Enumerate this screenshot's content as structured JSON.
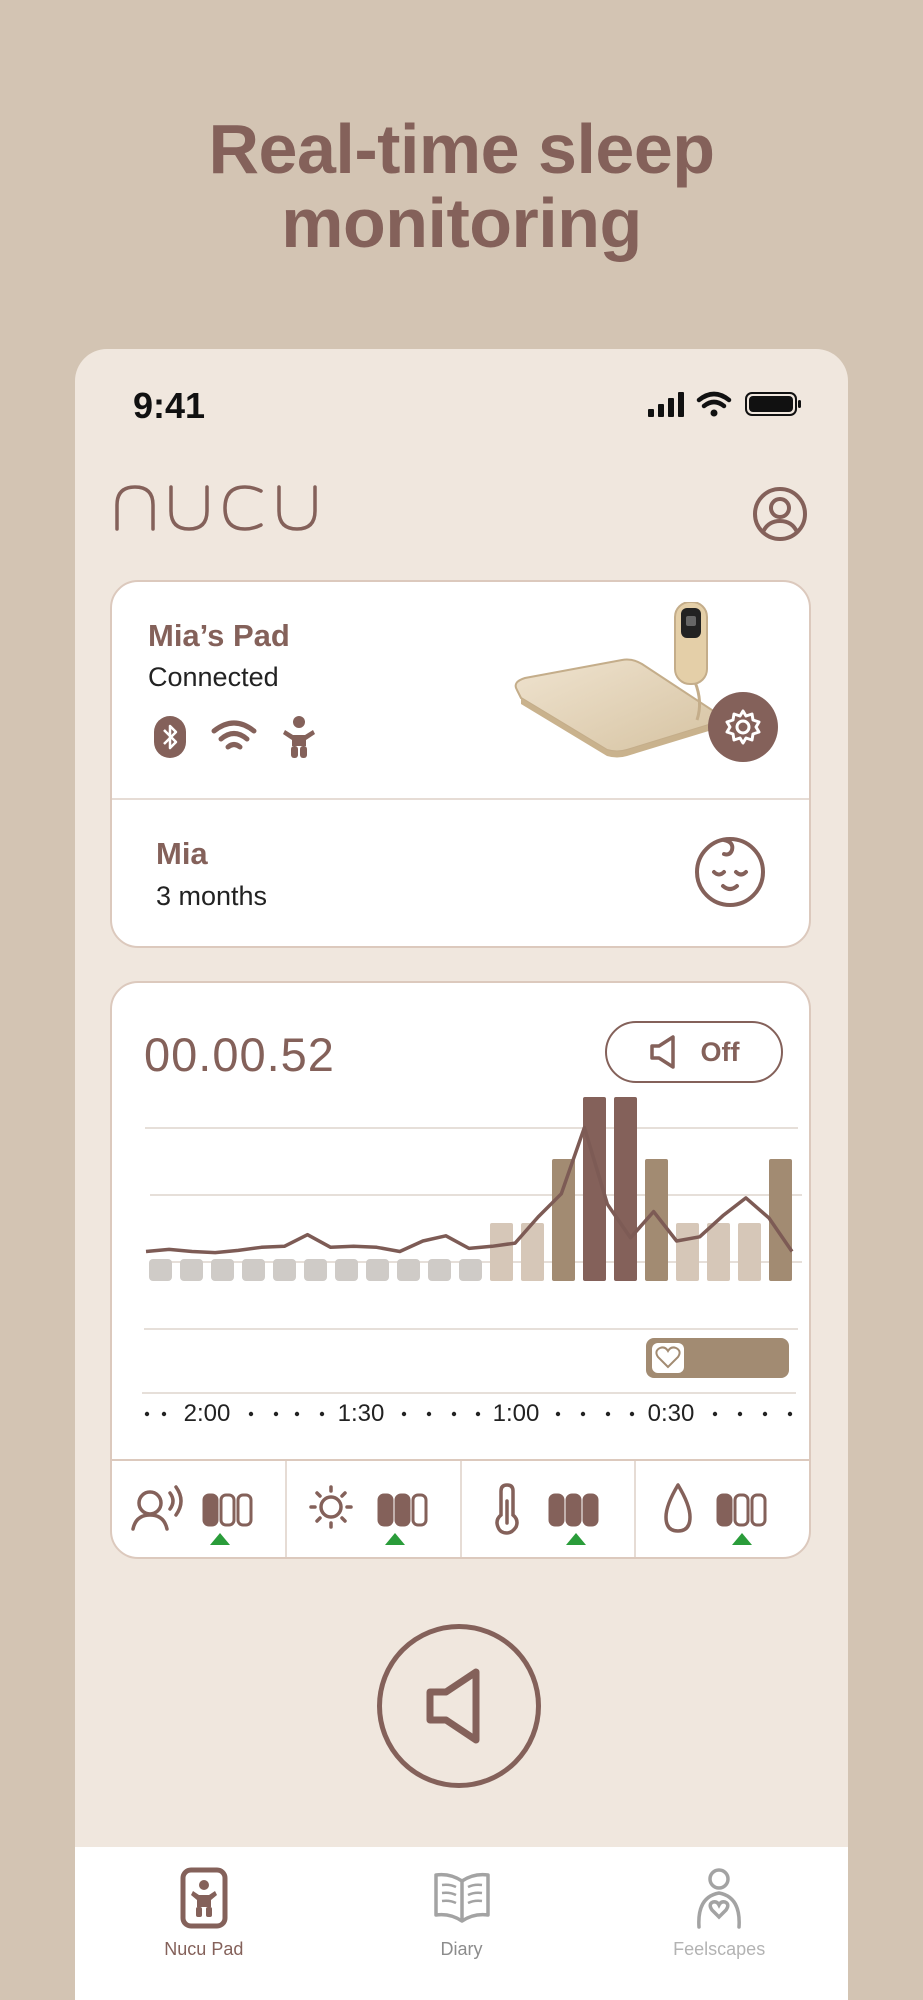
{
  "promo": {
    "headline_line1": "Real-time sleep",
    "headline_line2": "monitoring"
  },
  "status_bar": {
    "time": "9:41"
  },
  "app": {
    "logo_text": "nucu"
  },
  "device": {
    "name": "Mia’s Pad",
    "status": "Connected",
    "icons": [
      "bluetooth-icon",
      "wifi-icon",
      "baby-icon",
      "settings-gear-icon"
    ]
  },
  "baby": {
    "name": "Mia",
    "age": "3 months"
  },
  "monitor": {
    "timer": "00.00.52",
    "sound_toggle_label": "Off",
    "time_axis_labels": [
      "2:00",
      "1:30",
      "1:00",
      "0:30"
    ]
  },
  "chart_data": {
    "type": "bar",
    "bar_levels": [
      0,
      0,
      0,
      0,
      0,
      0,
      0,
      0,
      0,
      0,
      0,
      1,
      1,
      2,
      3,
      3,
      2,
      1,
      1,
      1,
      2
    ],
    "bar_level_legend": {
      "0": "none",
      "1": "light",
      "2": "medium",
      "3": "high"
    },
    "line_values": [
      3.0,
      3.2,
      3.0,
      2.9,
      3.1,
      3.4,
      3.5,
      4.6,
      3.4,
      3.5,
      3.4,
      3.0,
      4.0,
      4.5,
      3.3,
      3.5,
      3.8,
      6.3,
      8.5,
      14.8,
      7.5,
      4.3,
      6.8,
      4.0,
      4.4,
      6.4,
      8.1,
      6.2,
      3.0
    ],
    "colors": {
      "none": "#cfcbc7",
      "light": "#d6c7b8",
      "medium": "#a28b72",
      "high": "#84615a",
      "line": "#7d5b55"
    }
  },
  "sensors": [
    {
      "icon": "voice-icon",
      "level": 1,
      "trend": "up"
    },
    {
      "icon": "sun-icon",
      "level": 2,
      "trend": "up"
    },
    {
      "icon": "thermometer-icon",
      "level": 3,
      "trend": "up"
    },
    {
      "icon": "humidity-drop-icon",
      "level": 1,
      "trend": "up"
    }
  ],
  "tabs": [
    {
      "label": "Nucu Pad",
      "active": true,
      "icon": "nucu-pad-icon"
    },
    {
      "label": "Diary",
      "active": false,
      "icon": "book-icon"
    },
    {
      "label": "Feelscapes",
      "active": false,
      "icon": "mother-baby-icon"
    }
  ],
  "colors": {
    "brand": "#84615a",
    "background": "#d3c4b3",
    "screen": "#f0e7de",
    "trend_up": "#2a9c3a"
  }
}
